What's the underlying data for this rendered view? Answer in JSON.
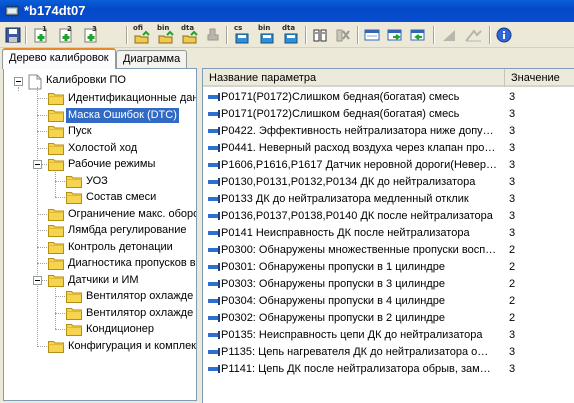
{
  "window": {
    "title": "*b174dt07"
  },
  "toolbar": {
    "items": [
      {
        "name": "save-icon"
      },
      {
        "name": "add-1-icon",
        "text": "1"
      },
      {
        "name": "add-2-icon",
        "text": "2"
      },
      {
        "name": "add-3-icon",
        "text": "3"
      },
      {
        "name": "open-ofi-icon",
        "text": "ofi"
      },
      {
        "name": "open-bin-icon",
        "text": "bin"
      },
      {
        "name": "open-dta-icon",
        "text": "dta"
      },
      {
        "name": "stamp-icon"
      },
      {
        "name": "save-cs-icon",
        "text": "cs"
      },
      {
        "name": "save-bin-icon",
        "text": "bin"
      },
      {
        "name": "save-dta-icon",
        "text": "dta"
      },
      {
        "name": "compare-icon"
      },
      {
        "name": "swap-icon"
      },
      {
        "name": "window-icon"
      },
      {
        "name": "export-icon"
      },
      {
        "name": "import-icon"
      },
      {
        "name": "chart-icon"
      },
      {
        "name": "graph-icon"
      },
      {
        "name": "info-icon"
      }
    ]
  },
  "tabs": [
    {
      "label": "Дерево калибровок",
      "active": true
    },
    {
      "label": "Диаграмма",
      "active": false
    }
  ],
  "tree": {
    "root": "Калибровки ПО",
    "items": [
      {
        "label": "Идентификационные дан",
        "level": 1
      },
      {
        "label": "Маска Ошибок (DTC)",
        "level": 1,
        "selected": true
      },
      {
        "label": "Пуск",
        "level": 1
      },
      {
        "label": "Холостой ход",
        "level": 1
      },
      {
        "label": "Рабочие режимы",
        "level": 1,
        "expanded": true
      },
      {
        "label": "УОЗ",
        "level": 2
      },
      {
        "label": "Состав смеси",
        "level": 2
      },
      {
        "label": "Ограничение макс. оборо",
        "level": 1
      },
      {
        "label": "Лямбда регулирование",
        "level": 1
      },
      {
        "label": "Контроль детонации",
        "level": 1
      },
      {
        "label": "Диагностика пропусков в",
        "level": 1
      },
      {
        "label": "Датчики и ИМ",
        "level": 1,
        "expanded": true
      },
      {
        "label": "Вентилятор охлажде",
        "level": 2
      },
      {
        "label": "Вентилятор охлажде",
        "level": 2
      },
      {
        "label": "Кондиционер",
        "level": 2
      },
      {
        "label": "Конфигурация и комплект",
        "level": 1
      }
    ]
  },
  "list": {
    "columns": {
      "name": "Название параметра",
      "value": "Значение"
    },
    "rows": [
      {
        "name": "P0171(P0172)Слишком бедная(богатая) смесь",
        "value": "3"
      },
      {
        "name": "P0171(P0172)Слишком бедная(богатая) смесь",
        "value": "3"
      },
      {
        "name": "P0422. Эффективность нейтрализатора ниже допу…",
        "value": "3"
      },
      {
        "name": "P0441. Неверный расход воздуха через клапан про…",
        "value": "3"
      },
      {
        "name": "P1606,P1616,P1617 Датчик неровной дороги(Невер…",
        "value": "3"
      },
      {
        "name": "P0130,P0131,P0132,P0134 ДК до нейтрализатора",
        "value": "3"
      },
      {
        "name": "P0133 ДК до нейтрализатора медленный отклик",
        "value": "3"
      },
      {
        "name": "P0136,P0137,P0138,P0140 ДК после нейтрализатора",
        "value": "3"
      },
      {
        "name": "P0141 Неисправность ДК после нейтрализатора",
        "value": "3"
      },
      {
        "name": "P0300: Обнаружены множественные пропуски восп…",
        "value": "2"
      },
      {
        "name": "P0301: Обнаружены пропуски в 1 цилиндре",
        "value": "2"
      },
      {
        "name": "P0303: Обнаружены пропуски в 3 цилиндре",
        "value": "2"
      },
      {
        "name": "P0304: Обнаружены пропуски в 4 цилиндре",
        "value": "2"
      },
      {
        "name": "P0302: Обнаружены пропуски в 2 цилиндре",
        "value": "2"
      },
      {
        "name": "P0135: Неисправность цепи ДК до нейтрализатора",
        "value": "3"
      },
      {
        "name": "P1135: Цепь нагревателя ДК до нейтрализатора о…",
        "value": "3"
      },
      {
        "name": "P1141: Цепь ДК после нейтрализатора обрыв, зам…",
        "value": "3"
      }
    ]
  },
  "colors": {
    "titlebar": "#0348c8",
    "selection": "#316ac5",
    "folder": "#f5d54f",
    "tab_accent": "#e68b2c"
  }
}
